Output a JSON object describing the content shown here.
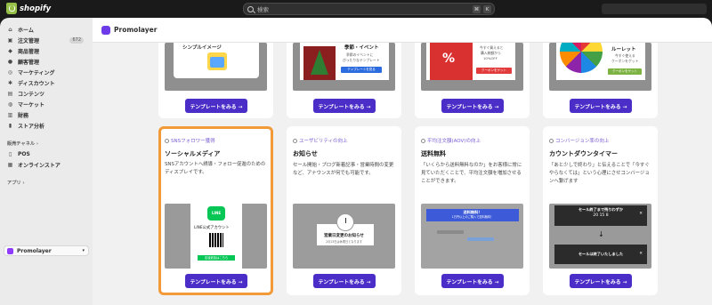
{
  "topbar": {
    "brand": "shopify",
    "search_placeholder": "検索",
    "shortcut_cmd": "⌘",
    "shortcut_key": "K"
  },
  "sidebar": {
    "items": [
      {
        "label": "ホーム",
        "icon": "home-icon"
      },
      {
        "label": "注文管理",
        "icon": "inbox-icon",
        "badge": "672"
      },
      {
        "label": "商品管理",
        "icon": "tag-icon"
      },
      {
        "label": "顧客管理",
        "icon": "person-icon"
      },
      {
        "label": "マーケティング",
        "icon": "target-icon"
      },
      {
        "label": "ディスカウント",
        "icon": "discount-icon"
      },
      {
        "label": "コンテンツ",
        "icon": "content-icon"
      },
      {
        "label": "マーケット",
        "icon": "globe-icon"
      },
      {
        "label": "財務",
        "icon": "bank-icon"
      },
      {
        "label": "ストア分析",
        "icon": "chart-icon"
      }
    ],
    "sales_channels_label": "販売チャネル",
    "channels": [
      {
        "label": "POS",
        "icon": "pos-icon"
      },
      {
        "label": "オンラインストア",
        "icon": "store-icon"
      }
    ],
    "apps_label": "アプリ",
    "app_selected": "Promolayer"
  },
  "header": {
    "title": "Promolayer"
  },
  "top_row": {
    "card1_text": "シンプルイメージ",
    "card2_title": "季節・イベント",
    "card2_sub1": "季節のイベントに",
    "card2_sub2": "ぴったりなテンプレート",
    "card2_btn": "テンプレートを見る",
    "card3_sub1": "今すぐ買えると",
    "card3_sub2": "購入総額から",
    "card3_sub3": "10%OFF",
    "card3_btn": "クーポンをゲット",
    "card4_title1": "ルーレット",
    "card4_sub1": "今すぐ使える",
    "card4_sub2": "クーポンをゲット",
    "card4_btn": "クーポンをゲット",
    "button_label": "テンプレートをみる →"
  },
  "cards": [
    {
      "tag": "SNSフォロワー獲得",
      "title": "ソーシャルメディア",
      "desc": "SNSアカウントへ誘導・フォロー促進のためのディスプレイです。",
      "preview_title": "LINE公式アカウント",
      "preview_logo": "LINE",
      "preview_btn": "友達追加はこちら",
      "button_label": "テンプレートをみる →"
    },
    {
      "tag": "ユーザビリティの向上",
      "title": "お知らせ",
      "desc": "セール開始・ブログ新着記事・営業時間の変更など、アナウンスが何でも可能です。",
      "preview_title": "営業日変更のお知らせ",
      "preview_sub": "2月13日は休業日となります",
      "button_label": "テンプレートをみる →"
    },
    {
      "tag": "平均注文額(AOV)の向上",
      "title": "送料無料",
      "desc": "「いくらから送料無料なのか」をお客様に常に見ていただくことで、平均注文額を増加させることができます。",
      "preview_title": "送料無料！",
      "preview_sub": "1万円以上のご購入で送料無料！",
      "button_label": "テンプレートをみる →"
    },
    {
      "tag": "コンバージョン率の向上",
      "title": "カウントダウンタイマー",
      "desc": "「あと少しで終わり」と伝えることで「今すぐやらなくては」という心理にさせコンバージョンへ繋げます",
      "preview_title": "セール終了まで残りわずか",
      "preview_timer": "20 15 8",
      "preview_end": "セールは終了いたしました",
      "button_label": "テンプレートをみる →"
    }
  ],
  "colors": {
    "accent": "#4b2ec8",
    "selected_border": "#f29a37",
    "line_green": "#06c755",
    "brand_green": "#95bf47"
  }
}
